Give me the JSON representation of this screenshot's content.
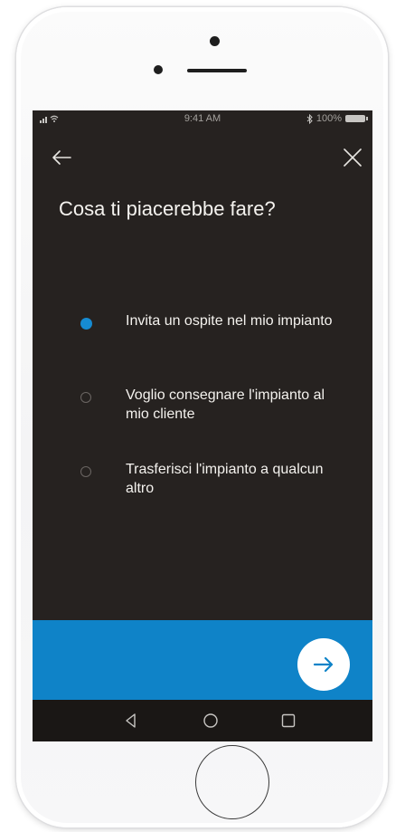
{
  "status_bar": {
    "time": "9:41 AM",
    "battery": "100%",
    "bluetooth_icon": "bluetooth-icon",
    "signal_icon": "signal-icon",
    "wifi_icon": "wifi-icon"
  },
  "header": {
    "back_icon": "arrow-left-icon",
    "close_icon": "close-icon"
  },
  "title": "Cosa ti piacerebbe fare?",
  "options": [
    {
      "label": "Invita un ospite nel mio impianto",
      "selected": true
    },
    {
      "label": "Voglio consegnare l'impianto al mio cliente",
      "selected": false
    },
    {
      "label": "Trasferisci l'impianto a qualcun altro",
      "selected": false
    }
  ],
  "next_button": {
    "icon": "arrow-right-icon"
  },
  "nav_bar": {
    "icons": [
      "back-triangle-icon",
      "home-circle-icon",
      "recents-square-icon"
    ]
  },
  "colors": {
    "screen_background": "#262220",
    "accent_blue": "#0f83c8",
    "radio_selected": "#168bd2",
    "text": "#f4f2ee"
  }
}
